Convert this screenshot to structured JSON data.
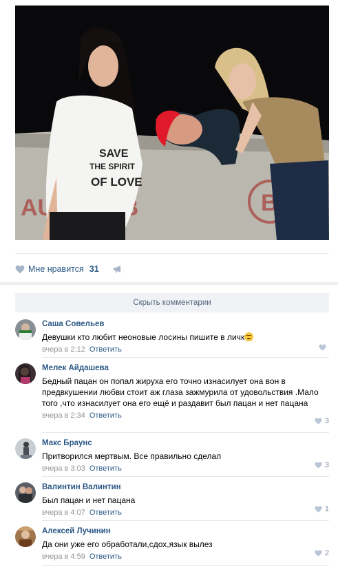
{
  "post": {
    "photo_text": {
      "shirt_line1": "SAVE",
      "shirt_line2": "THE SPIRIT",
      "shirt_line3": "OF LOVE",
      "wall_graffiti": "AUTHIATB",
      "wall_b": "B"
    },
    "like_label": "Мне нравится",
    "like_count": "31",
    "hide_comments_label": "Скрыть комментарии"
  },
  "comments": [
    {
      "author": "Саша Совельев",
      "text": "Девушки кто любит неоновые лосины пишите в личк",
      "time": "вчера в 2:12",
      "reply": "Ответить",
      "likes": "",
      "avatar_color": "#8a8f96"
    },
    {
      "author": "Мелек Айдашева",
      "text": "Бедный пацан он попал жируха его точно изнасилует она вон в предвкушении любви стоит аж глаза зажмурила от удовольствия .Мало того ,что изнасилует она его ещё и раздавит был пацан и нет пацана",
      "time": "вчера в 2:34",
      "reply": "Ответить",
      "likes": "3",
      "avatar_color": "#3b2f35"
    },
    {
      "author": "Макс Браунс",
      "text": "Притворился мертвым. Все правильно сделал",
      "time": "вчера в 3:03",
      "reply": "Ответить",
      "likes": "3",
      "avatar_color": "#6f7a84"
    },
    {
      "author": "Валинтин Валинтин",
      "text": "Был пацан и нет пацана",
      "time": "вчера в 4:07",
      "reply": "Ответить",
      "likes": "1",
      "avatar_color": "#5b5f66"
    },
    {
      "author": "Алексей Лучинин",
      "text": "Да они уже его обработали,сдох,язык вылез",
      "time": "вчера в 4:59",
      "reply": "Ответить",
      "likes": "2",
      "avatar_color": "#a0764d"
    }
  ],
  "colors": {
    "link": "#2a5885",
    "meta": "#939393",
    "separator": "#e7e8ec",
    "band": "#edeef0"
  },
  "icons": {
    "like": "heart-icon",
    "share": "megaphone-icon"
  }
}
